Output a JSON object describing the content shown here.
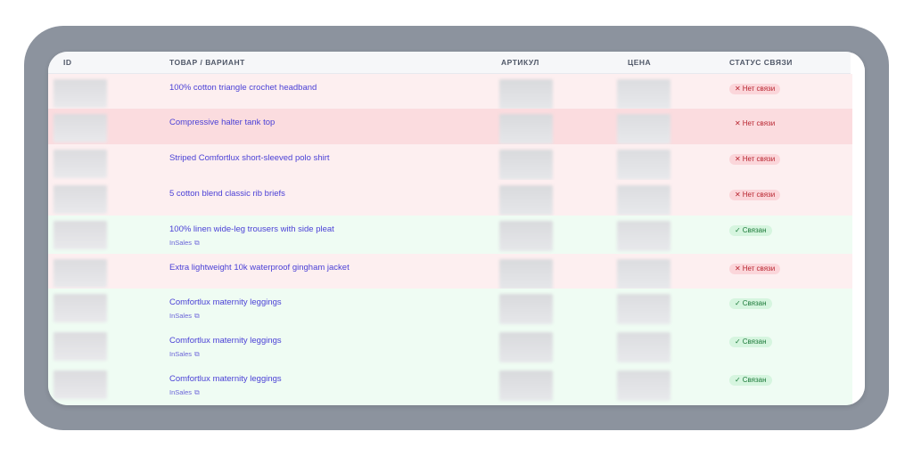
{
  "header": {
    "id": "ID",
    "product": "ТОВАР / ВАРИАНТ",
    "sku": "АРТИКУЛ",
    "price": "ЦЕНА",
    "status": "СТАТУС СВЯЗИ"
  },
  "colors": {
    "unlinked": "#fdeff0",
    "linked": "#effcf3",
    "link": "#4b41d6"
  },
  "rows": [
    {
      "name": "100% cotton triangle crochet headband",
      "status": "Нет связи",
      "linked": false
    },
    {
      "name": "Compressive halter tank top",
      "status": "Нет связи",
      "linked": false
    },
    {
      "name": "Striped Comfortlux short-sleeved polo shirt",
      "status": "Нет связи",
      "linked": false
    },
    {
      "name": "5 cotton blend classic rib briefs",
      "status": "Нет связи",
      "linked": false
    },
    {
      "name": "100% linen wide-leg trousers with side pleat",
      "source": "InSales",
      "status": "Связан",
      "linked": true
    },
    {
      "name": "Extra lightweight 10k waterproof gingham jacket",
      "status": "Нет связи",
      "linked": false
    },
    {
      "name": "Comfortlux maternity leggings",
      "source": "InSales",
      "status": "Связан",
      "linked": true
    },
    {
      "name": "Comfortlux maternity leggings",
      "source": "InSales",
      "status": "Связан",
      "linked": true
    },
    {
      "name": "Comfortlux maternity leggings",
      "source": "InSales",
      "status": "Связан",
      "linked": true
    }
  ],
  "icons": {
    "unlinked": "x-icon",
    "linked": "check-icon",
    "source": "copy-icon"
  }
}
